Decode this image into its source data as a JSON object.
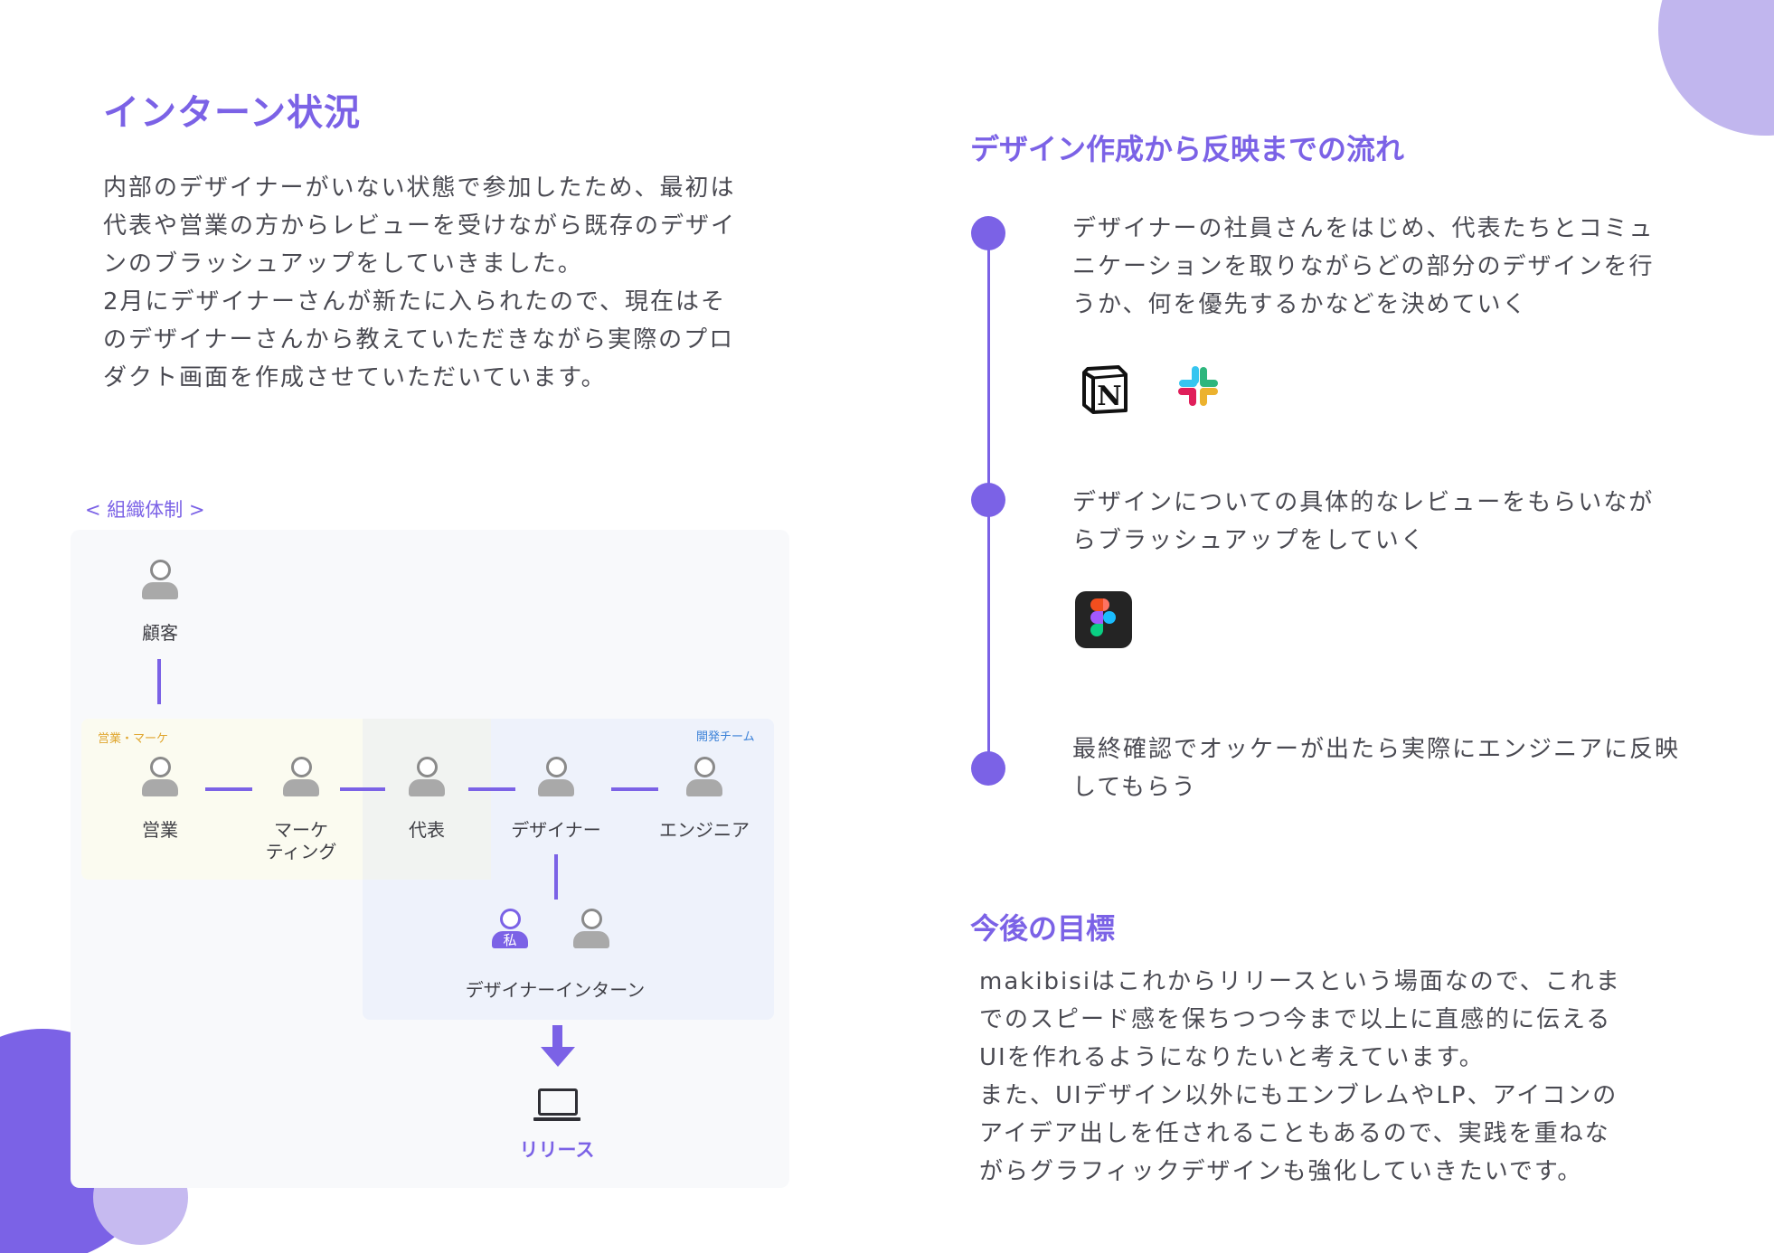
{
  "title": "インターン状況",
  "intro": [
    "内部のデザイナーがいない状態で参加したため、最初は",
    "代表や営業の方からレビューを受けながら既存のデザイ",
    "ンのブラッシュアップをしていきました。",
    "2月にデザイナーさんが新たに入られたので、現在はそ",
    "のデザイナーさんから教えていただきながら実際のプロ",
    "ダクト画面を作成させていただいています。"
  ],
  "org": {
    "caption": "< 組織体制 >",
    "zone_sales": "営業・マーケ",
    "zone_dev": "開発チーム",
    "customer": "顧客",
    "sales": "営業",
    "marketing_line1": "マーケ",
    "marketing_line2": "ティング",
    "ceo": "代表",
    "designer": "デザイナー",
    "engineer": "エンジニア",
    "me_badge": "私",
    "intern": "デザイナーインターン",
    "release": "リリース"
  },
  "flow": {
    "title": "デザイン作成から反映までの流れ",
    "steps": [
      {
        "lines": [
          "デザイナーの社員さんをはじめ、代表たちとコミュ",
          "ニケーションを取りながらどの部分のデザインを行",
          "うか、何を優先するかなどを決めていく"
        ],
        "tools": [
          "notion-icon",
          "slack-icon"
        ]
      },
      {
        "lines": [
          "デザインについての具体的なレビューをもらいなが",
          "らブラッシュアップをしていく"
        ],
        "tools": [
          "figma-icon"
        ]
      },
      {
        "lines": [
          "最終確認でオッケーが出たら実際にエンジニアに反映",
          "してもらう"
        ],
        "tools": []
      }
    ]
  },
  "notion_letter": "N",
  "goal": {
    "title": "今後の目標",
    "lines": [
      "makibisiはこれからリリースという場面なので、これま",
      "でのスピード感を保ちつつ今まで以上に直感的に伝える",
      "UIを作れるようになりたいと考えています。",
      "また、UIデザイン以外にもエンブレムやLP、アイコンの",
      "アイデア出しを任されることもあるので、実践を重ねな",
      "がらグラフィックデザインも強化していきたいです。"
    ]
  },
  "colors": {
    "accent": "#7b62e6",
    "accent_light": "#c1b6ee",
    "sales_zone": "#fbfbf0",
    "dev_zone": "#eef2fb",
    "sales_label": "#e0a630",
    "dev_label": "#3c82d8",
    "text": "#4a4a52"
  }
}
